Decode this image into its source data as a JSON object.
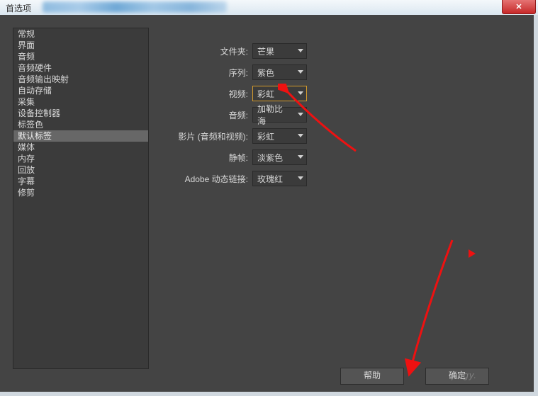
{
  "window": {
    "title": "首选项"
  },
  "sidebar": {
    "items": [
      {
        "label": "常规"
      },
      {
        "label": "界面"
      },
      {
        "label": "音频"
      },
      {
        "label": "音频硬件"
      },
      {
        "label": "音频输出映射"
      },
      {
        "label": "自动存储"
      },
      {
        "label": "采集"
      },
      {
        "label": "设备控制器"
      },
      {
        "label": "标签色"
      },
      {
        "label": "默认标签",
        "selected": true
      },
      {
        "label": "媒体"
      },
      {
        "label": "内存"
      },
      {
        "label": "回放"
      },
      {
        "label": "字幕"
      },
      {
        "label": "修剪"
      }
    ]
  },
  "form": {
    "rows": [
      {
        "label": "文件夹:",
        "value": "芒果"
      },
      {
        "label": "序列:",
        "value": "紫色"
      },
      {
        "label": "视频:",
        "value": "彩虹",
        "highlight": true
      },
      {
        "label": "音频:",
        "value": "加勒比海"
      },
      {
        "label": "影片 (音频和视频):",
        "value": "彩虹"
      },
      {
        "label": "静帧:",
        "value": "淡紫色"
      },
      {
        "label": "Adobe 动态链接:",
        "value": "玫瑰红"
      }
    ]
  },
  "buttons": {
    "help": "帮助",
    "ok": "确定"
  },
  "watermark": "jingy."
}
